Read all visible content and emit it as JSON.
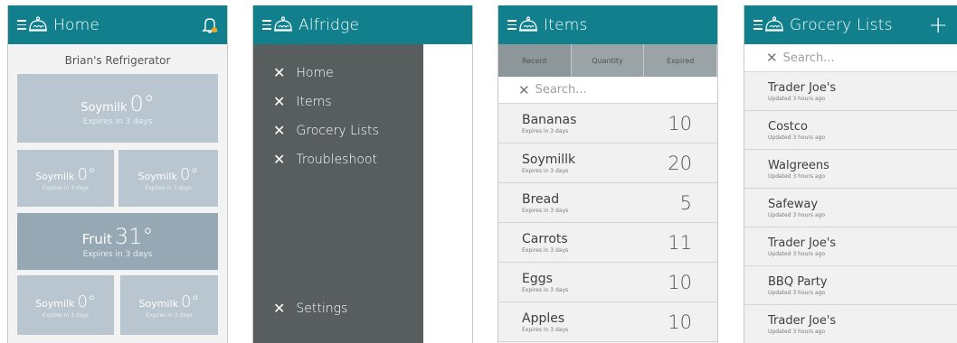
{
  "home": {
    "title": "Home",
    "icon": "bell-icon",
    "fridge_name": "Brian's Refrigerator",
    "tiles": [
      {
        "name": "Soymilk",
        "temp": "0°",
        "expires": "Expires in 3 days"
      },
      {
        "name": "Soymilk",
        "temp": "0°",
        "expires": "Expires in 3 days"
      },
      {
        "name": "Soymilk",
        "temp": "0°",
        "expires": "Expires in 3 days"
      },
      {
        "name": "Fruit",
        "temp": "31°",
        "expires": "Expires in 3 days"
      },
      {
        "name": "Soymilk",
        "temp": "0°",
        "expires": "Expires in 3 days"
      },
      {
        "name": "Soymilk",
        "temp": "0°",
        "expires": "Expires in 3 days"
      }
    ]
  },
  "drawer": {
    "title": "Alfridge",
    "items": [
      "Home",
      "Items",
      "Grocery Lists",
      "Troubleshoot"
    ],
    "settings": "Settings"
  },
  "items": {
    "title": "Items",
    "tabs": [
      "Recent",
      "Quantity",
      "Expired"
    ],
    "search_placeholder": "Search...",
    "rows": [
      {
        "name": "Bananas",
        "expires": "Expires in 3 days",
        "qty": "10"
      },
      {
        "name": "Soymillk",
        "expires": "Expires in 3 days",
        "qty": "20"
      },
      {
        "name": "Bread",
        "expires": "Expires in 3 days",
        "qty": "5"
      },
      {
        "name": "Carrots",
        "expires": "Expires in 3 days",
        "qty": "11"
      },
      {
        "name": "Eggs",
        "expires": "Expires in 3 days",
        "qty": "10"
      },
      {
        "name": "Apples",
        "expires": "Expires in 3 days",
        "qty": "10"
      }
    ]
  },
  "grocery": {
    "title": "Grocery Lists",
    "add_label": "+",
    "search_placeholder": "Search...",
    "lists": [
      {
        "name": "Trader Joe's",
        "updated": "Updated 3 hours ago"
      },
      {
        "name": "Costco",
        "updated": "Updated 3 hours ago"
      },
      {
        "name": "Walgreens",
        "updated": "Updated 3 hours ago"
      },
      {
        "name": "Safeway",
        "updated": "Updated 3 hours ago"
      },
      {
        "name": "Trader Joe's",
        "updated": "Updated 3 hours ago"
      },
      {
        "name": "BBQ Party",
        "updated": "Updated 3 hours ago"
      },
      {
        "name": "Trader Joe's",
        "updated": "Updated 3 hours ago"
      }
    ]
  },
  "colors": {
    "primary": "#11808c",
    "drawer": "#575e5d",
    "tile": "#b9c6cf",
    "tile_dark": "#95a8b4",
    "accent": "#f5a623"
  }
}
